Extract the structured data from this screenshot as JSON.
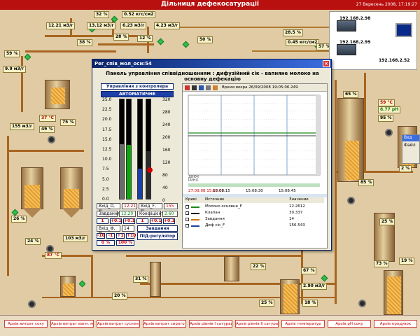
{
  "header": {
    "title": "Дільниця дефекосатурації",
    "date": "27 Вересень 2008, 17:19:27"
  },
  "values": {
    "v32": "32 %",
    "p052": "0.52 кгс/см2",
    "f1221": "12.21 м3/г",
    "f1312": "13.12 м3/г",
    "f623": "6.23 м3/г",
    "f423": "4.23 м3/г",
    "v28a": "28 %",
    "v12": "12 %",
    "v38": "38 %",
    "v50": "50 %",
    "v285": "28.5 %",
    "p045": "0.45 кгс/см2",
    "v57": "57 %",
    "v59": "59 %",
    "f99": "9.9 м3/г",
    "v37c": "37 °C",
    "v49": "49 %",
    "v75": "75 %",
    "f155": "155 м3/г",
    "v26": "26 %",
    "v24": "24 %",
    "f103": "103 м3/г",
    "v87c": "87 °C",
    "v31": "31 %",
    "v20": "20 %",
    "v22": "22 %",
    "v67": "67 %",
    "f290": "2.90 м3/г",
    "v18": "18 %",
    "v25": "25 %",
    "v65": "65 %",
    "v59c": "59 °C",
    "ph877": "8.77 pH",
    "v95": "95 %",
    "v2": "2 %",
    "v85": "85 %",
    "v25b": "25 %",
    "v19": "19 %",
    "v73": "73 %"
  },
  "network": {
    "ip1": "192.168.2.98",
    "ip2": "192.168.2.99",
    "ip3": "192.168.2.52"
  },
  "side_panel": {
    "label": "Вхд",
    "file": "Файл"
  },
  "popup": {
    "window_title": "Рег_спів_мол_осн:54",
    "close": "×",
    "subtitle": "Панель управління співвідношенням : дифузійний сік - вапняне молоко на основну дефекацію",
    "control_mode": "Управління з контролера",
    "auto": "АВТОМАТИЧНЕ",
    "scale_left": [
      "25.0",
      "22.5",
      "20.0",
      "17.5",
      "15.0",
      "12.5",
      "10.0",
      "7.5",
      "5.0",
      "2.5",
      "0.0"
    ],
    "scale_right": [
      "320",
      "280",
      "240",
      "200",
      "160",
      "120",
      "80",
      "40",
      "0"
    ],
    "input_d": "Вхід_D, %",
    "input_d_val": "12.21",
    "input_f": "Вхід_F, %",
    "input_f_val": "155",
    "setpoint_label": "Завдання",
    "setpoint_val": "12.20",
    "coef_label": "Коефіцієнт",
    "coef_val": "2.60",
    "mini": [
      "1",
      "+0.1",
      "+0.1",
      "1",
      "+0.1",
      "+0.1"
    ],
    "output_label": "Вхід_Ф, %",
    "output_val": "14",
    "setpoint2_label": "Завдання",
    "step_btns": [
      "-10",
      "-1",
      "+1",
      "+10"
    ],
    "pct_btns": [
      "0 %",
      "100 %"
    ],
    "pid_label": "ПІД-регулятор",
    "toolbar_time": "Время визра 26/09/2008 19:05:06.249",
    "chart_x_labels": [
      "27.09.08 15:08:00",
      "15:08:15",
      "15:08:30",
      "15:08:45"
    ],
    "legend_headers": [
      "Криві",
      "Источник",
      "Значение"
    ],
    "legend_rows": [
      {
        "name": "Молоко основне_F",
        "value": "12.2612",
        "color": "#1a8a1a"
      },
      {
        "name": "Клапан",
        "value": "30.337",
        "color": "#000000"
      },
      {
        "name": "Завдання",
        "value": "14",
        "color": "#d07010"
      },
      {
        "name": "Диф сік_F",
        "value": "156.543",
        "color": "#1a3fa8"
      }
    ],
    "chart_extra": [
      "ДИФК",
      "РИНО"
    ]
  },
  "archives": [
    "Архів витрат соку",
    "Архів витрат вапн. молока",
    "Архів витрат суспензії",
    "Архів витрат сирого соку",
    "Архів рівнів І сатурації",
    "Архів рівнів ІІ сатурації",
    "Архів температур",
    "Архів рН соку",
    "Архів продувок"
  ]
}
